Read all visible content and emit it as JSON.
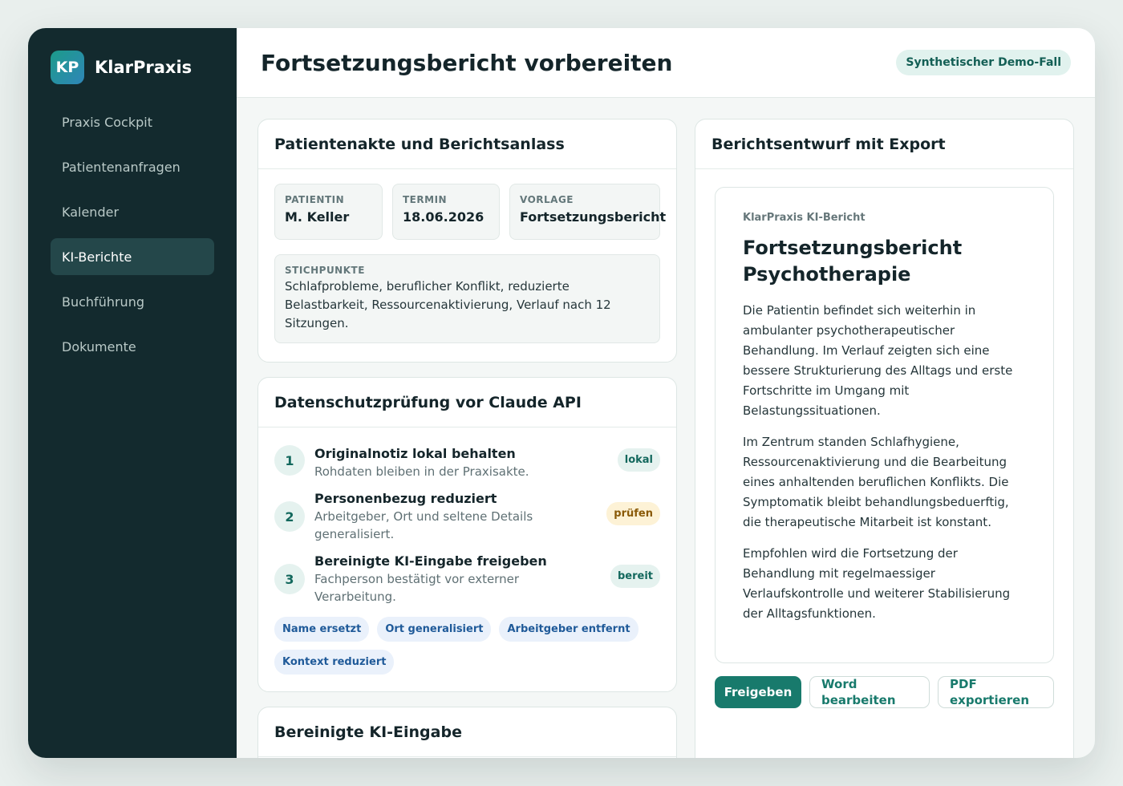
{
  "app": {
    "logo_initials": "KP",
    "name": "KlarPraxis"
  },
  "nav": {
    "items": [
      {
        "label": "Praxis Cockpit"
      },
      {
        "label": "Patientenanfragen"
      },
      {
        "label": "Kalender"
      },
      {
        "label": "KI-Berichte",
        "active": true
      },
      {
        "label": "Buchführung"
      },
      {
        "label": "Dokumente"
      }
    ]
  },
  "header": {
    "title": "Fortsetzungsbericht vorbereiten",
    "badge": "Synthetischer Demo-Fall"
  },
  "patient_card": {
    "title": "Patientenakte und Berichtsanlass",
    "fields": [
      {
        "label": "PATIENTIN",
        "value": "M. Keller"
      },
      {
        "label": "TERMIN",
        "value": "18.06.2026"
      },
      {
        "label": "VORLAGE",
        "value": "Fortsetzungsbericht"
      }
    ],
    "notes_label": "STICHPUNKTE",
    "notes": "Schlafprobleme, beruflicher Konflikt, reduzierte Belastbarkeit, Ressourcenaktivierung, Verlauf nach 12 Sitzungen."
  },
  "privacy_card": {
    "title": "Datenschutzprüfung vor Claude API",
    "steps": [
      {
        "num": "1",
        "title": "Originalnotiz lokal behalten",
        "desc": "Rohdaten bleiben in der Praxisakte.",
        "badge": "lokal"
      },
      {
        "num": "2",
        "title": "Personenbezug reduziert",
        "desc": "Arbeitgeber, Ort und seltene Details generalisiert.",
        "badge": "prüfen"
      },
      {
        "num": "3",
        "title": "Bereinigte KI-Eingabe freigeben",
        "desc": "Fachperson bestätigt vor externer Verarbeitung.",
        "badge": "bereit"
      }
    ],
    "tags": [
      "Name ersetzt",
      "Ort generalisiert",
      "Arbeitgeber entfernt",
      "Kontext reduziert"
    ],
    "colors": {
      "ok_bg": "#e5f2ef",
      "ok_fg": "#13685d",
      "warn_bg": "#fdf2d6",
      "warn_fg": "#8a5a08"
    }
  },
  "input_card": {
    "title": "Bereinigte KI-Eingabe"
  },
  "report_card": {
    "title": "Berichtsentwurf mit Export",
    "kicker": "KlarPraxis KI-Bericht",
    "doc_title": "Fortsetzungsbericht Psychotherapie",
    "paragraphs": [
      "Die Patientin befindet sich weiterhin in ambulanter psychotherapeutischer Behandlung. Im Verlauf zeigten sich eine bessere Strukturierung des Alltags und erste Fortschritte im Umgang mit Belastungssituationen.",
      "Im Zentrum standen Schlafhygiene, Ressourcenaktivierung und die Bearbeitung eines anhaltenden beruflichen Konflikts. Die Symptomatik bleibt behandlungsbeduerftig, die therapeutische Mitarbeit ist konstant.",
      "Empfohlen wird die Fortsetzung der Behandlung mit regelmaessiger Verlaufskontrolle und weiterer Stabilisierung der Alltagsfunktionen."
    ],
    "actions": {
      "approve": "Freigeben",
      "word": "Word bearbeiten",
      "pdf": "PDF exportieren"
    }
  }
}
